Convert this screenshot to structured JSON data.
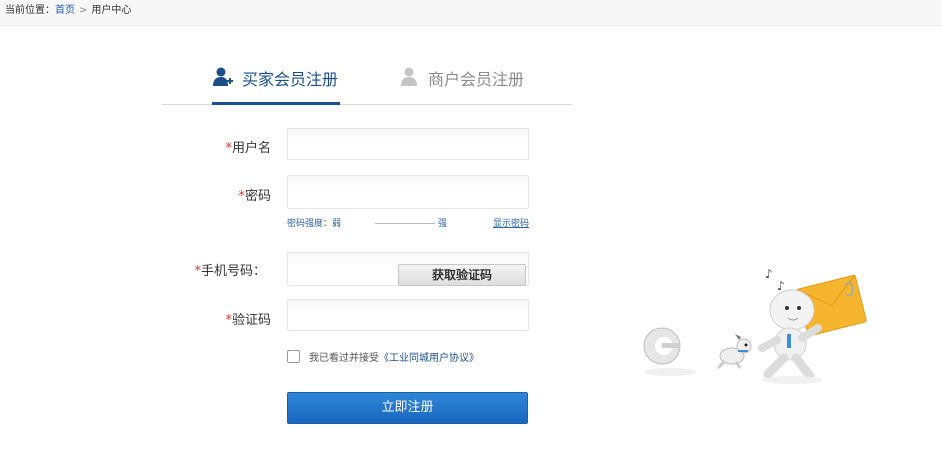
{
  "breadcrumb": {
    "prefix": "当前位置：",
    "home": "首页",
    "separator": ">",
    "current": "用户中心"
  },
  "tabs": {
    "buyer": "买家会员注册",
    "seller": "商户会员注册"
  },
  "form": {
    "username_label": "用户名",
    "password_label": "密码",
    "phone_label": "手机号码：",
    "code_label": "验证码",
    "required_mark": "*",
    "strength_prefix": "密码强度：弱",
    "strength_strong": "强",
    "show_password": "显示密码",
    "get_code": "获取验证码",
    "agree_prefix": "我已看过并接受",
    "agreement": "《工业同城用户协议》",
    "submit": "立即注册"
  },
  "colors": {
    "accent": "#1a4f8b",
    "required": "#d9342b",
    "button": "#1967bf"
  }
}
